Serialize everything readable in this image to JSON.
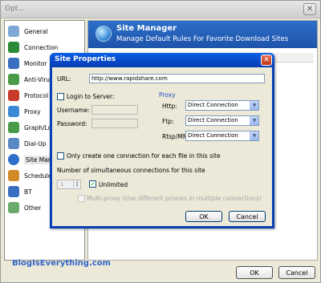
{
  "outer": {
    "title": "Opt...",
    "close_glyph": "✕",
    "ok_label": "OK",
    "cancel_label": "Cancel"
  },
  "sidebar": {
    "items": [
      {
        "label": "General",
        "icon": "general-icon",
        "color": "#7fa8d6"
      },
      {
        "label": "Connection",
        "icon": "connection-icon",
        "color": "#2a8a3a"
      },
      {
        "label": "Monitor",
        "icon": "monitor-icon",
        "color": "#3a6fbf"
      },
      {
        "label": "Anti-Virus",
        "icon": "anti-virus-icon",
        "color": "#4a9a4a"
      },
      {
        "label": "Protocol",
        "icon": "protocol-icon",
        "color": "#c83a2a"
      },
      {
        "label": "Proxy",
        "icon": "proxy-icon",
        "color": "#3a8ad6"
      },
      {
        "label": "Graph/Log",
        "icon": "graph-log-icon",
        "color": "#4a9a4a"
      },
      {
        "label": "Dial-Up",
        "icon": "dial-up-icon",
        "color": "#5a8ac6"
      },
      {
        "label": "Site Manag",
        "icon": "site-manager-icon",
        "color": "#2f6fc7"
      },
      {
        "label": "Schedule/E",
        "icon": "schedule-icon",
        "color": "#d08a2a"
      },
      {
        "label": "BT",
        "icon": "bt-icon",
        "color": "#3a6fbf"
      },
      {
        "label": "Other",
        "icon": "other-icon",
        "color": "#6aaa6a"
      }
    ]
  },
  "site_manager": {
    "title": "Site Manager",
    "subtitle": "Manage Default Rules For Favorite Download Sites"
  },
  "watermark": "BlogIsEverything.com",
  "dialog": {
    "title": "Site Properties",
    "close_glyph": "✕",
    "url_label": "URL:",
    "url_value": "http://www.rapidshare.com",
    "login_label": "Login to Server:",
    "username_label": "Username:",
    "password_label": "Password:",
    "proxy_label": "Proxy",
    "http_label": "Http:",
    "ftp_label": "Ftp:",
    "rtsp_label": "Rtsp/MMS",
    "http_value": "Direct Connection",
    "ftp_value": "Direct Connection",
    "rtsp_value": "Direct Connection",
    "one_connection_label": "Only create one connection for each file in this site",
    "simultaneous_label": "Number of simultaneous connections for this site",
    "spinner_value": "1",
    "unlimited_label": "Unlimited",
    "multi_proxy_label": "Multi-proxy (Use different proxies in multiple connections)",
    "ok_label": "OK",
    "cancel_label": "Cancel",
    "check_glyph": "✓",
    "dropdown_glyph": "▼"
  }
}
